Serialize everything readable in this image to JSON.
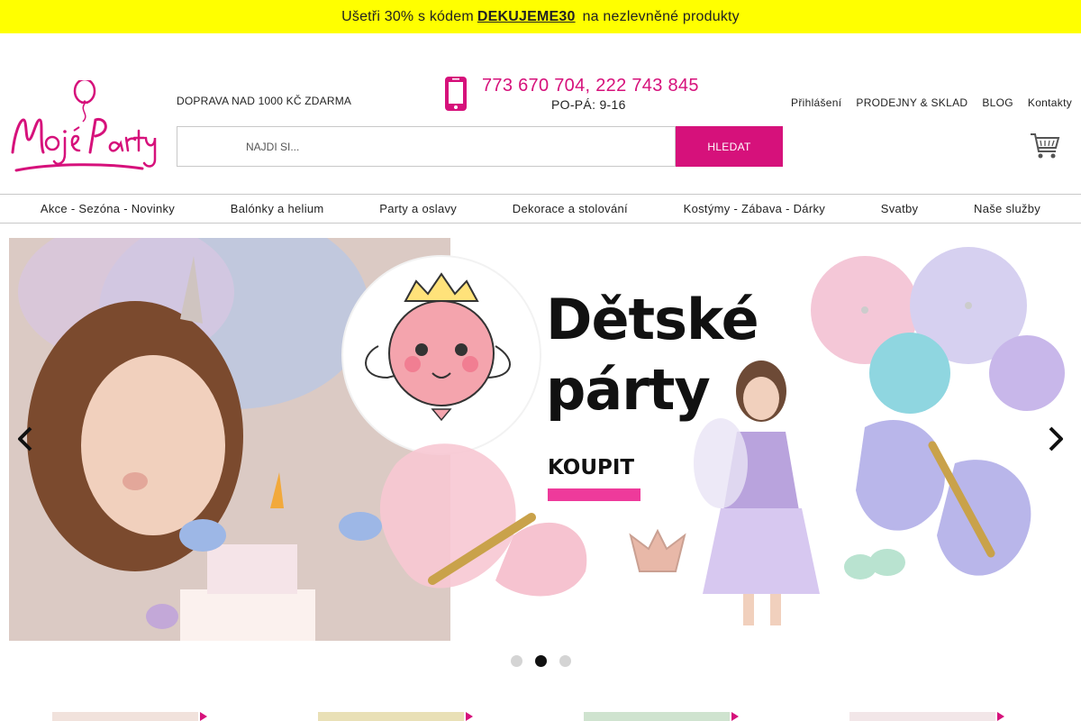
{
  "promo": {
    "prefix": "Ušetři 30% s kódem",
    "code": "DEKUJEME30",
    "suffix": "na nezlevněné produkty"
  },
  "brand": {
    "name": "Moje Party",
    "accent": "#d6117b"
  },
  "header": {
    "shipping": "DOPRAVA NAD 1000 KČ ZDARMA",
    "phones": "773 670 704, 222 743 845",
    "hours": "PO-PÁ: 9-16",
    "links": [
      "Přihlášení",
      "PRODEJNY & SKLAD",
      "BLOG",
      "Kontakty"
    ]
  },
  "search": {
    "placeholder": "NAJDI SI...",
    "button": "HLEDAT",
    "value": ""
  },
  "nav": [
    "Akce - Sezóna - Novinky",
    "Balónky a helium",
    "Party a oslavy",
    "Dekorace a stolování",
    "Kostýmy - Zábava - Dárky",
    "Svatby",
    "Naše služby"
  ],
  "banner": {
    "title_line1": "Dětské",
    "title_line2": "párty",
    "cta": "KOUPIT",
    "active_slide": 2,
    "slide_count": 3
  },
  "icons": [
    "phone-icon",
    "cart-icon",
    "chevron-left-icon",
    "chevron-right-icon"
  ]
}
